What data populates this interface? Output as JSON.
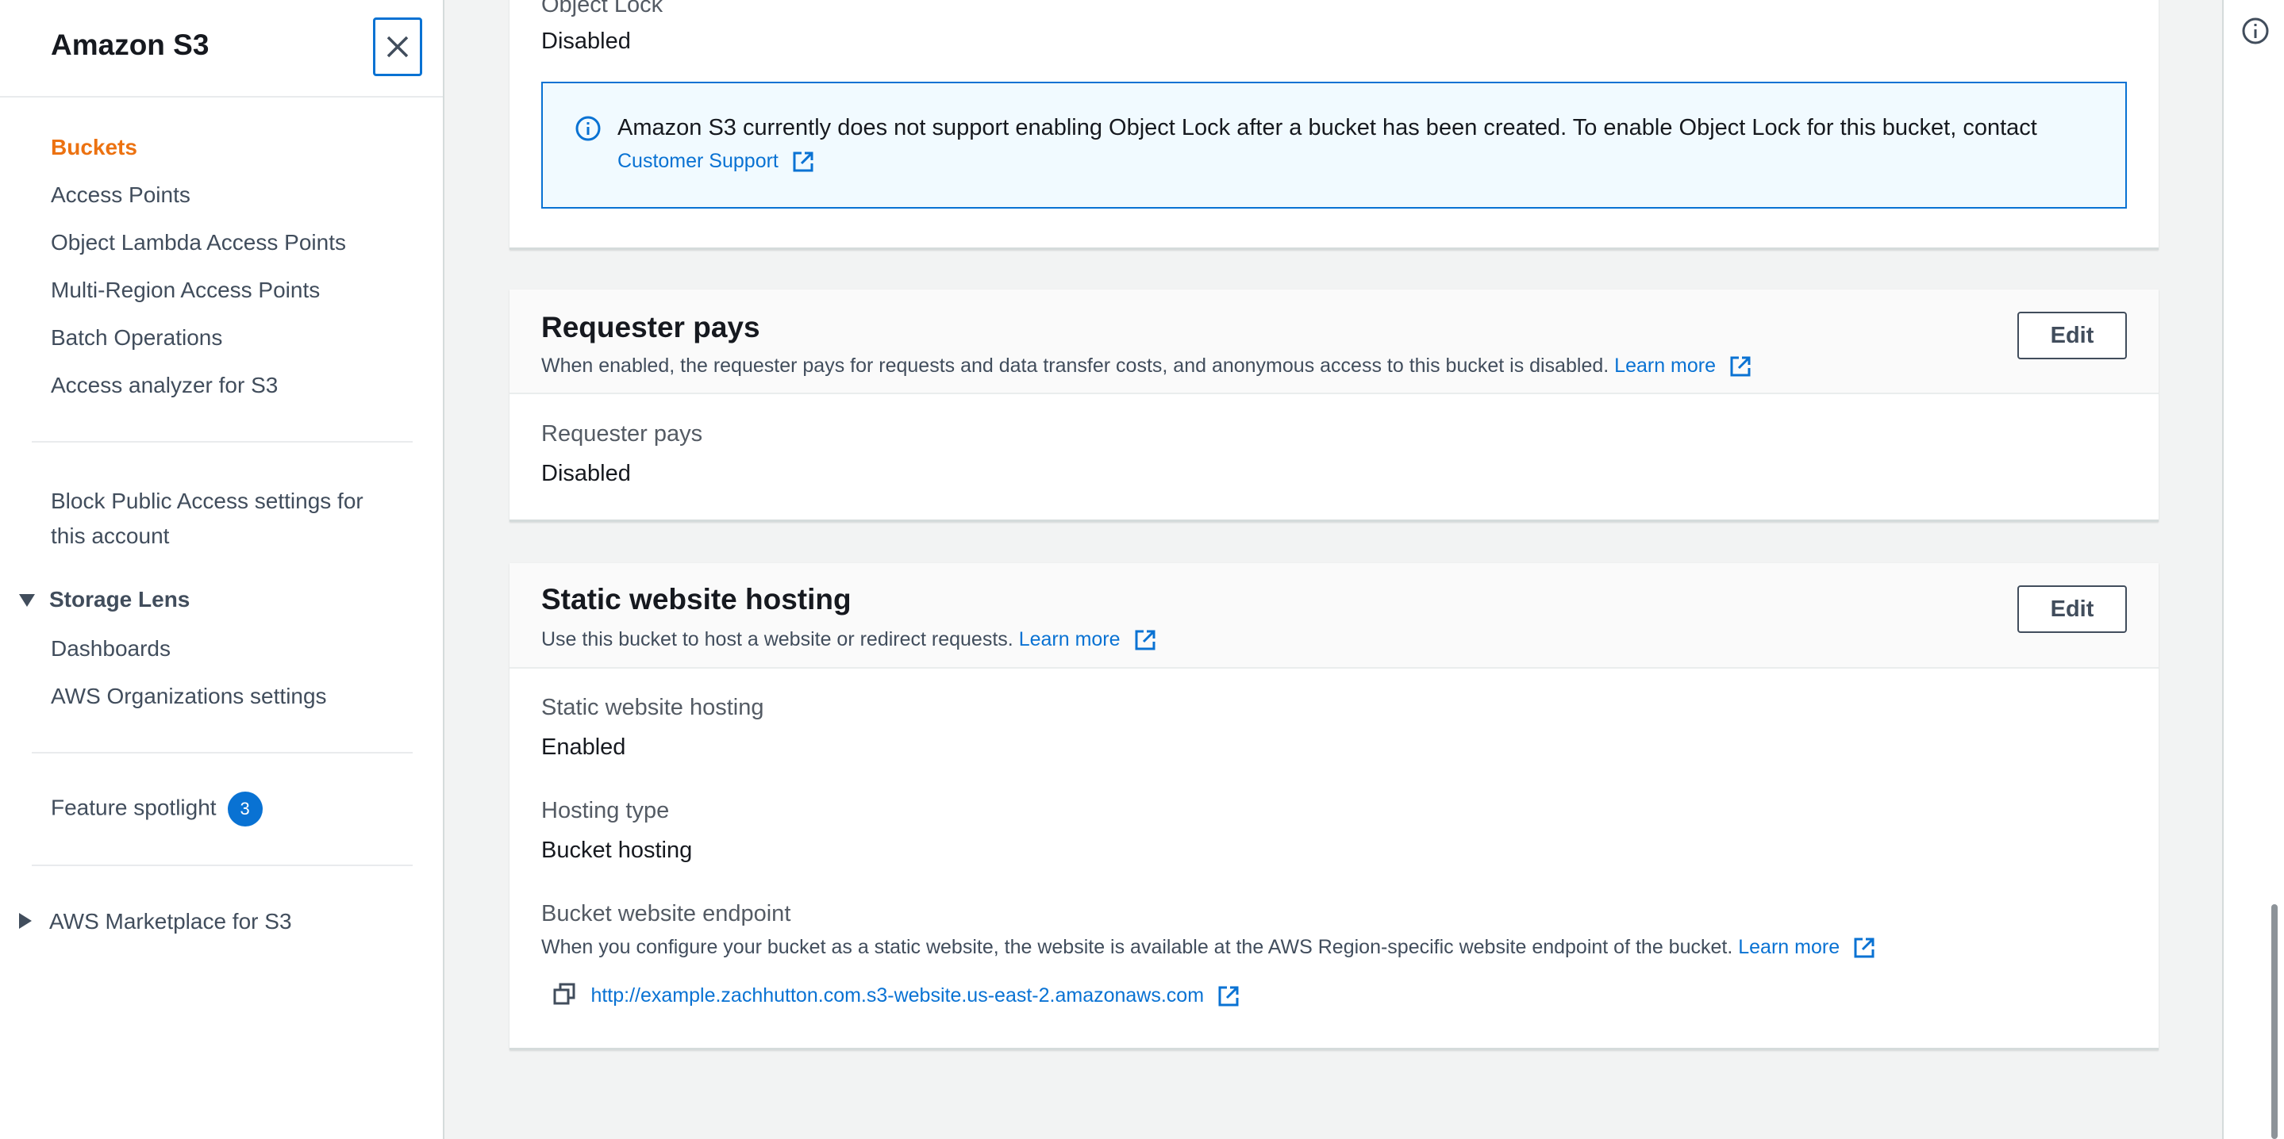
{
  "sidebar": {
    "title": "Amazon S3",
    "items": [
      {
        "label": "Buckets",
        "active": true
      },
      {
        "label": "Access Points"
      },
      {
        "label": "Object Lambda Access Points"
      },
      {
        "label": "Multi-Region Access Points"
      },
      {
        "label": "Batch Operations"
      },
      {
        "label": "Access analyzer for S3"
      }
    ],
    "block_public_access": {
      "line1": "Block Public Access settings for",
      "line2": "this account"
    },
    "storage_lens": {
      "label": "Storage Lens",
      "items": [
        {
          "label": "Dashboards"
        },
        {
          "label": "AWS Organizations settings"
        }
      ]
    },
    "feature_spotlight": {
      "label": "Feature spotlight",
      "badge": "3"
    },
    "marketplace": {
      "label": "AWS Marketplace for S3"
    }
  },
  "object_lock": {
    "label": "Object Lock",
    "value": "Disabled",
    "info": {
      "text": "Amazon S3 currently does not support enabling Object Lock after a bucket has been created. To enable Object Lock for this bucket, contact",
      "link": "Customer Support"
    }
  },
  "requester_pays": {
    "title": "Requester pays",
    "description": "When enabled, the requester pays for requests and data transfer costs, and anonymous access to this bucket is disabled.",
    "learn_more": "Learn more",
    "edit_label": "Edit",
    "field_label": "Requester pays",
    "field_value": "Disabled"
  },
  "static_website": {
    "title": "Static website hosting",
    "description": "Use this bucket to host a website or redirect requests.",
    "learn_more": "Learn more",
    "edit_label": "Edit",
    "hosting_label": "Static website hosting",
    "hosting_value": "Enabled",
    "type_label": "Hosting type",
    "type_value": "Bucket hosting",
    "endpoint_label": "Bucket website endpoint",
    "endpoint_description": "When you configure your bucket as a static website, the website is available at the AWS Region-specific website endpoint of the bucket.",
    "endpoint_learn_more": "Learn more",
    "endpoint_url": "http://example.zachhutton.com.s3-website.us-east-2.amazonaws.com"
  },
  "colors": {
    "accent": "#0972d3",
    "active_nav": "#ec7211"
  }
}
